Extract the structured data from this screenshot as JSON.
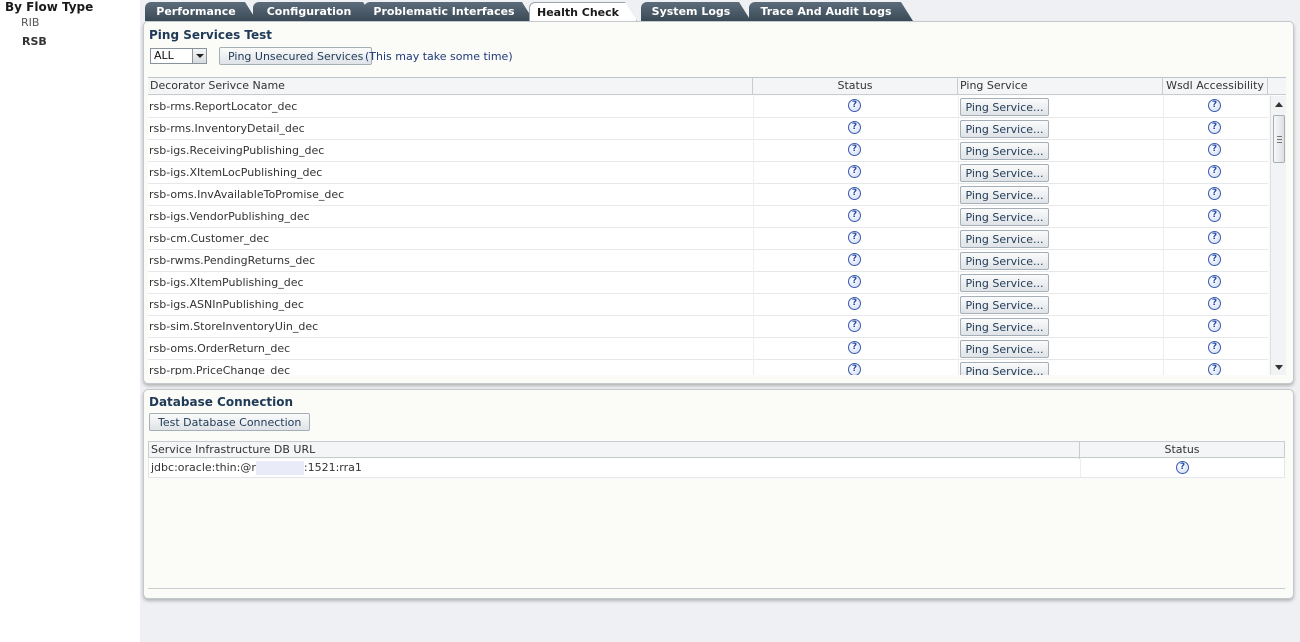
{
  "left_nav": {
    "heading": "By Flow Type",
    "items": [
      "RIB",
      "RSB"
    ]
  },
  "tabs": [
    {
      "label": "Performance",
      "active": false
    },
    {
      "label": "Configuration",
      "active": false
    },
    {
      "label": "Problematic Interfaces",
      "active": false
    },
    {
      "label": "Health Check",
      "active": true
    },
    {
      "label": "System Logs",
      "active": false
    },
    {
      "label": "Trace And Audit Logs",
      "active": false
    }
  ],
  "ping_section": {
    "title": "Ping Services Test",
    "filter_value": "ALL",
    "ping_button": "Ping Unsecured Services",
    "hint": "(This may take some time)",
    "columns": [
      "Decorator Serivce Name",
      "Status",
      "Ping Service",
      "Wsdl Accessibility"
    ],
    "row_button_label": "Ping Service...",
    "status_icon": "question-icon",
    "rows": [
      "rsb-rms.ReportLocator_dec",
      "rsb-rms.InventoryDetail_dec",
      "rsb-igs.ReceivingPublishing_dec",
      "rsb-igs.XItemLocPublishing_dec",
      "rsb-oms.InvAvailableToPromise_dec",
      "rsb-igs.VendorPublishing_dec",
      "rsb-cm.Customer_dec",
      "rsb-rwms.PendingReturns_dec",
      "rsb-igs.XItemPublishing_dec",
      "rsb-igs.ASNInPublishing_dec",
      "rsb-sim.StoreInventoryUin_dec",
      "rsb-oms.OrderReturn_dec",
      "rsb-rpm.PriceChange_dec"
    ]
  },
  "db_section": {
    "title": "Database Connection",
    "test_button": "Test Database Connection",
    "columns": [
      "Service Infrastructure DB URL",
      "Status"
    ],
    "row": {
      "url_prefix": "jdbc:oracle:thin:@r",
      "url_suffix": ":1521:rra1"
    }
  },
  "colors": {
    "tab_bg": "#4a5a68",
    "panel_title": "#1f3a57",
    "icon_blue": "#3b5db0"
  }
}
